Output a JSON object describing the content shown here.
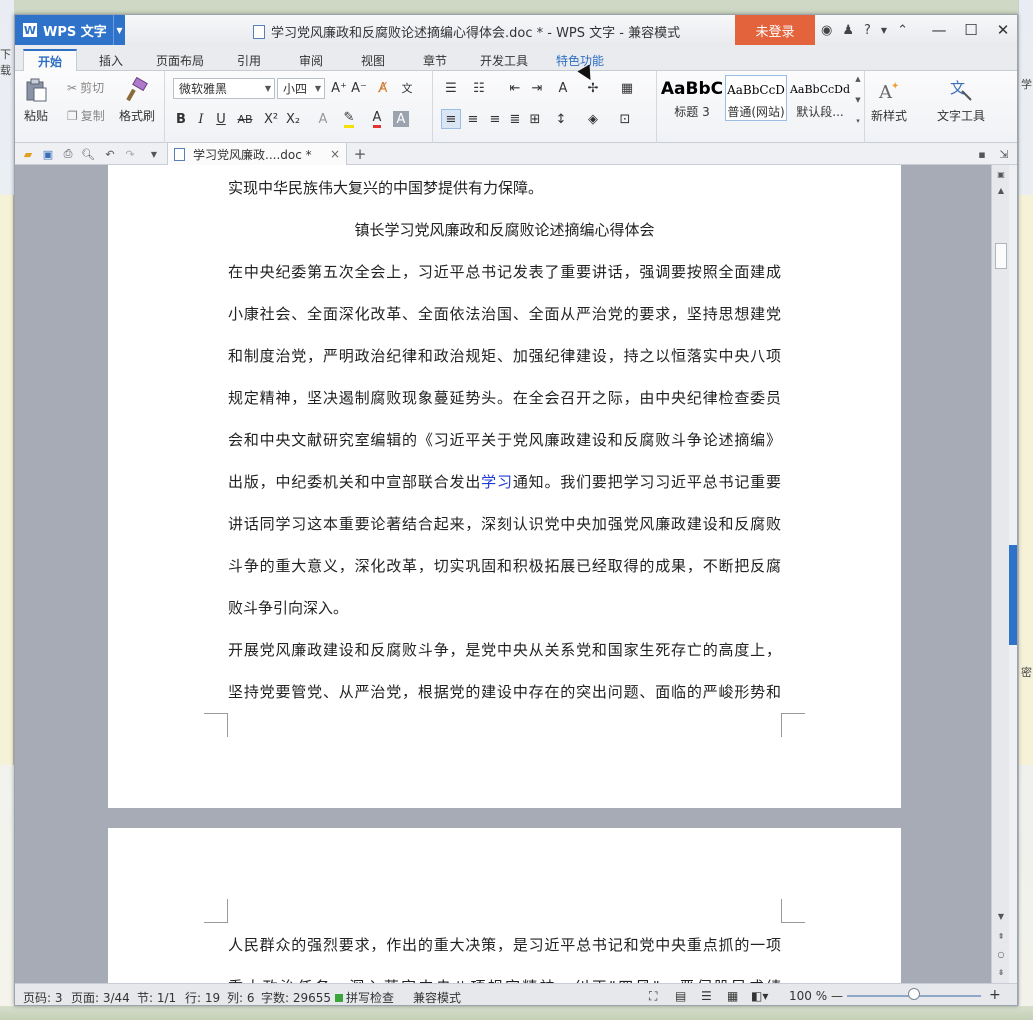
{
  "desktop": {
    "left_text": "下载",
    "right_text_1": "学",
    "right_text_2": "密"
  },
  "app": {
    "name": "WPS 文字",
    "logo": "W",
    "title": "学习党风廉政和反腐败论述摘编心得体会.doc * - WPS 文字 - 兼容模式",
    "login": "未登录"
  },
  "window_controls": {
    "minimize": "—",
    "maximize": "☐",
    "close": "✕",
    "help": "?",
    "skin_icon": "shirt-icon",
    "restore_icon": "collapse-ribbon-icon"
  },
  "tabs": [
    "开始",
    "插入",
    "页面布局",
    "引用",
    "审阅",
    "视图",
    "章节",
    "开发工具",
    "特色功能"
  ],
  "ribbon": {
    "paste": "粘贴",
    "cut": "剪切",
    "copy": "复制",
    "format_painter": "格式刷",
    "font_name": "微软雅黑",
    "font_size": "小四",
    "styles": [
      {
        "sample": "AaBbC",
        "label": "标题 3"
      },
      {
        "sample": "AaBbCcD",
        "label": "普通(网站)"
      },
      {
        "sample": "AaBbCcDd",
        "label": "默认段..."
      }
    ],
    "new_style": "新样式",
    "text_tools": "文字工具"
  },
  "doc_tab": {
    "label": "学习党风廉政....doc *",
    "close": "×",
    "add": "+"
  },
  "document": {
    "page1_lines": [
      {
        "text": "实现中华民族伟大复兴的中国梦提供有力保障。",
        "last": true
      },
      {
        "text": "镇长学习党风廉政和反腐败论述摘编心得体会",
        "center": true
      },
      {
        "text": "在中央纪委第五次全会上，习近平总书记发表了重要讲话，强调要按照全面建成"
      },
      {
        "text": "小康社会、全面深化改革、全面依法治国、全面从严治党的要求，坚持思想建党"
      },
      {
        "text": "和制度治党，严明政治纪律和政治规矩、加强纪律建设，持之以恒落实中央八项"
      },
      {
        "text": "规定精神，坚决遏制腐败现象蔓延势头。在全会召开之际，由中央纪律检查委员"
      },
      {
        "text": "会和中央文献研究室编辑的《习近平关于党风廉政建设和反腐败斗争论述摘编》"
      },
      {
        "pre": "出版，中纪委机关和中宣部联合发出",
        "link": "学习",
        "post": "通知。我们要把学习习近平总书记重要"
      },
      {
        "text": "讲话同学习这本重要论著结合起来，深刻认识党中央加强党风廉政建设和反腐败"
      },
      {
        "text": "斗争的重大意义，深化改革，切实巩固和积极拓展已经取得的成果，不断把反腐"
      },
      {
        "text": "败斗争引向深入。",
        "last": true
      },
      {
        "text": "开展党风廉政建设和反腐败斗争，是党中央从关系党和国家生死存亡的高度上，"
      },
      {
        "text": "坚持党要管党、从严治党，根据党的建设中存在的突出问题、面临的严峻形势和"
      }
    ],
    "page2_lines": [
      {
        "text": "人民群众的强烈要求，作出的重大决策，是习近平总书记和党中央重点抓的一项"
      },
      {
        "text": "重大政治任务。深入落实中央八项规定精神，纠正\"四风\"，严伺股民成绩"
      }
    ]
  },
  "status": {
    "page_num": "页码: 3",
    "pages": "页面: 3/44",
    "section": "节: 1/1",
    "row": "行: 19",
    "col": "列: 6",
    "words": "字数: 29655",
    "spell": "拼写检查",
    "compat": "兼容模式",
    "zoom": "100 %",
    "zoom_level": 0.5
  }
}
